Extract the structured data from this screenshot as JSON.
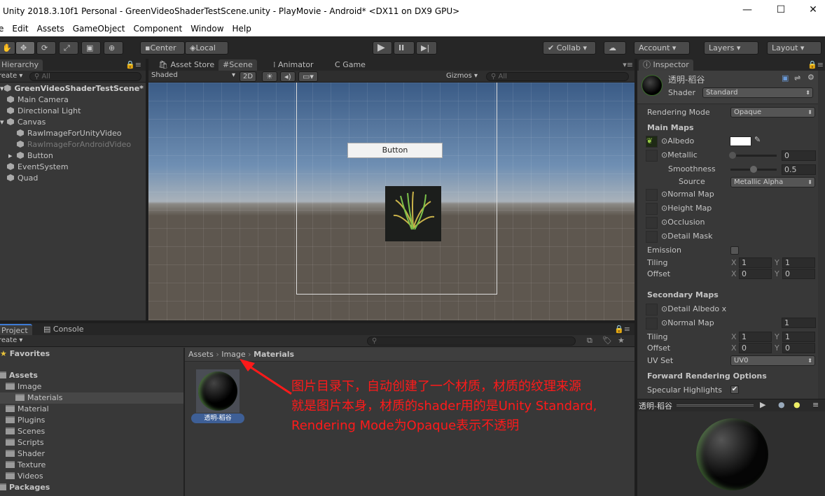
{
  "window": {
    "title": "Unity 2018.3.10f1 Personal - GreenVideoShaderTestScene.unity - PlayMovie - Android* <DX11 on DX9 GPU>",
    "minimize": "—",
    "maximize": "☐",
    "close": "✕"
  },
  "menu": [
    "e",
    "Edit",
    "Assets",
    "GameObject",
    "Component",
    "Window",
    "Help"
  ],
  "toolbar": {
    "tools": [
      "hand-tool",
      "move-tool",
      "rotate-tool",
      "scale-tool",
      "rect-tool",
      "transform-tool"
    ],
    "center": "Center",
    "local": "Local",
    "collab": "Collab ▾",
    "account": "Account ▾",
    "layers": "Layers ▾",
    "layout": "Layout ▾"
  },
  "hierarchy": {
    "tab": "Hierarchy",
    "create": "reate ▾",
    "search": "All",
    "scene": "GreenVideoShaderTestScene*",
    "items": [
      {
        "label": "Main Camera",
        "depth": 0,
        "disabled": false
      },
      {
        "label": "Directional Light",
        "depth": 0,
        "disabled": false
      },
      {
        "label": "Canvas",
        "depth": 0,
        "disabled": false
      },
      {
        "label": "RawImageForUnityVideo",
        "depth": 1,
        "disabled": false
      },
      {
        "label": "RawImageForAndroidVideo",
        "depth": 1,
        "disabled": true
      },
      {
        "label": "Button",
        "depth": 1,
        "disabled": false
      },
      {
        "label": "EventSystem",
        "depth": 0,
        "disabled": false
      },
      {
        "label": "Quad",
        "depth": 0,
        "disabled": false
      }
    ]
  },
  "scene": {
    "tabs": [
      "Asset Store",
      "Scene",
      "Animator",
      "Game"
    ],
    "active_tab": "Scene",
    "shading": "Shaded",
    "mode_2d": "2D",
    "gizmos": "Gizmos ▾",
    "search": "All",
    "button_label": "Button"
  },
  "inspector": {
    "tab": "Inspector",
    "material_name": "透明-稻谷",
    "shader_label": "Shader",
    "shader": "Standard",
    "rendering_mode_label": "Rendering Mode",
    "rendering_mode": "Opaque",
    "main_maps": "Main Maps",
    "albedo": "Albedo",
    "metallic": "Metallic",
    "metallic_value": "0",
    "smoothness": "Smoothness",
    "smoothness_value": "0.5",
    "source": "Source",
    "source_value": "Metallic Alpha",
    "normal_map": "Normal Map",
    "height_map": "Height Map",
    "occlusion": "Occlusion",
    "detail_mask": "Detail Mask",
    "emission": "Emission",
    "tiling": "Tiling",
    "offset": "Offset",
    "x": "X",
    "y": "Y",
    "tiling_x": "1",
    "tiling_y": "1",
    "offset_x": "0",
    "offset_y": "0",
    "secondary_maps": "Secondary Maps",
    "detail_albedo": "Detail Albedo x",
    "normal_map2": "Normal Map",
    "normal_map2_value": "1",
    "tiling2_x": "1",
    "tiling2_y": "1",
    "offset2_x": "0",
    "offset2_y": "0",
    "uv_set": "UV Set",
    "uv_set_value": "UV0",
    "forward_options": "Forward Rendering Options",
    "specular_highlights": "Specular Highlights",
    "specular_checked": true,
    "preview_name": "透明-稻谷"
  },
  "project": {
    "tabs": [
      "Project",
      "Console"
    ],
    "create": "reate ▾",
    "favorites": "Favorites",
    "assets": "Assets",
    "tree": [
      {
        "label": "Image",
        "depth": 1,
        "expanded": true
      },
      {
        "label": "Materials",
        "depth": 2,
        "selected": true
      },
      {
        "label": "Material",
        "depth": 1
      },
      {
        "label": "Plugins",
        "depth": 1
      },
      {
        "label": "Scenes",
        "depth": 1
      },
      {
        "label": "Scripts",
        "depth": 1
      },
      {
        "label": "Shader",
        "depth": 1
      },
      {
        "label": "Texture",
        "depth": 1
      },
      {
        "label": "Videos",
        "depth": 1
      }
    ],
    "packages": "Packages",
    "breadcrumb": [
      "Assets",
      "Image",
      "Materials"
    ],
    "asset_name": "透明-稻谷"
  },
  "annotation": [
    "图片目录下，自动创建了一个材质，材质的纹理来源",
    "就是图片本身，材质的shader用的是Unity Standard,",
    "Rendering Mode为Opaque表示不透明"
  ],
  "colors": {
    "annotation": "#ff1a1a",
    "selection": "#3e5f96"
  }
}
